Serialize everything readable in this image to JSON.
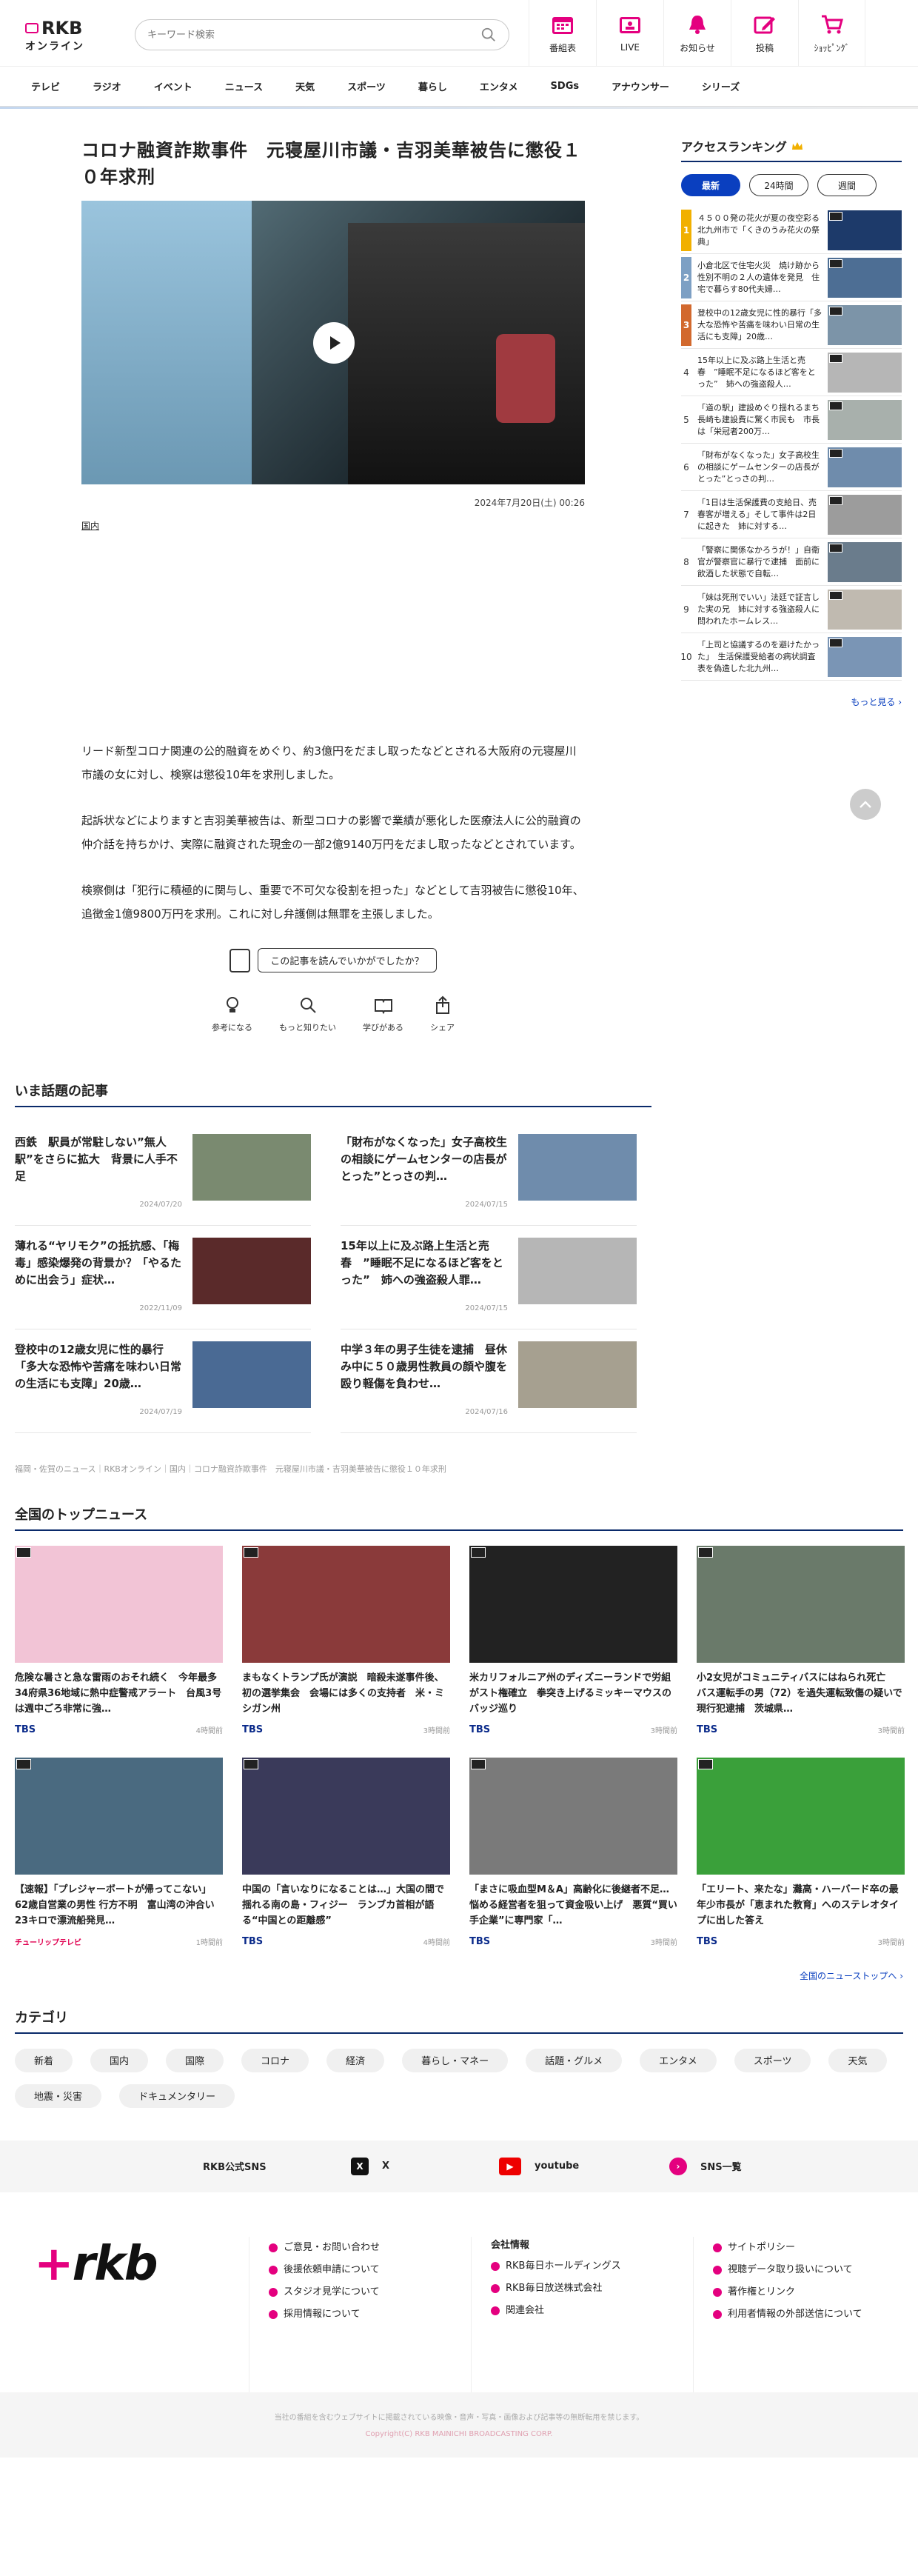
{
  "header": {
    "logo_main": "RKB",
    "logo_sub": "オンライン",
    "search_placeholder": "キーワード検索",
    "nav": [
      {
        "label": "番組表",
        "icon": "calendar-icon"
      },
      {
        "label": "LIVE",
        "icon": "live-icon"
      },
      {
        "label": "お知らせ",
        "icon": "bell-icon"
      },
      {
        "label": "投稿",
        "icon": "post-icon"
      },
      {
        "label": "ｼｮｯﾋﾟﾝｸﾞ",
        "icon": "cart-icon"
      }
    ]
  },
  "global_nav": [
    "テレビ",
    "ラジオ",
    "イベント",
    "ニュース",
    "天気",
    "スポーツ",
    "暮らし",
    "エンタメ",
    "SDGs",
    "アナウンサー",
    "シリーズ"
  ],
  "article": {
    "title": "コロナ融資詐欺事件　元寝屋川市議・吉羽美華被告に懲役１０年求刑",
    "date": "2024年7月20日(土) 00:26",
    "category": "国内",
    "paragraphs": [
      "リード新型コロナ関連の公的融資をめぐり、約3億円をだまし取ったなどとされる大阪府の元寝屋川市議の女に対し、検察は懲役10年を求刑しました。",
      "起訴状などによりますと吉羽美華被告は、新型コロナの影響で業績が悪化した医療法人に公的融資の仲介話を持ちかけ、実際に融資された現金の一部2億9140万円をだまし取ったなどとされています。",
      "検察側は「犯行に積極的に関与し、重要で不可欠な役割を担った」などとして吉羽被告に懲役10年、追徴金1億9800万円を求刑。これに対し弁護側は無罪を主張しました。"
    ],
    "feedback_question": "この記事を読んでいかがでしたか？",
    "reactions": [
      {
        "label": "参考になる",
        "icon": "lightbulb-icon"
      },
      {
        "label": "もっと知りたい",
        "icon": "magnifier-icon"
      },
      {
        "label": "学びがある",
        "icon": "book-icon"
      },
      {
        "label": "シェア",
        "icon": "share-icon"
      }
    ]
  },
  "ranking": {
    "title": "アクセスランキング",
    "tabs": [
      "最新",
      "24時間",
      "週間"
    ],
    "items": [
      {
        "rank": "1",
        "color": "#f1b000",
        "thumb": "#1d3a6a",
        "text": "４５００発の花火が夏の夜空彩る　北九州市で「くきのうみ花火の祭典」"
      },
      {
        "rank": "2",
        "color": "#7da0c4",
        "thumb": "#4d6e94",
        "text": "小倉北区で住宅火災　焼け跡から性別不明の２人の遺体を発見　住宅で暮らす80代夫婦…"
      },
      {
        "rank": "3",
        "color": "#d2692e",
        "thumb": "#7c94a8",
        "text": "登校中の12歳女児に性的暴行「多大な恐怖や苦痛を味わい日常の生活にも支障」20歳…"
      },
      {
        "rank": "4",
        "color": "",
        "thumb": "#b6b6b6",
        "text": "15年以上に及ぶ路上生活と売春　”睡眠不足になるほど客をとった”　姉への強盗殺人…"
      },
      {
        "rank": "5",
        "color": "",
        "thumb": "#a8b0ac",
        "text": "「道の駅」建設めぐり揺れるまち　長崎も建設費に驚く市民も　市長は「栄冠者200万…"
      },
      {
        "rank": "6",
        "color": "",
        "thumb": "#6f8cac",
        "text": "「財布がなくなった」女子高校生の相談にゲームセンターの店長がとった”とっさの判…"
      },
      {
        "rank": "7",
        "color": "",
        "thumb": "#9c9c9c",
        "text": "「1日は生活保護費の支給日、売春客が増える」そして事件は2日に起きた　姉に対する…"
      },
      {
        "rank": "8",
        "color": "",
        "thumb": "#6a7c8c",
        "text": "「警察に関係なかろうが！」自衛官が警察官に暴行で逮捕　面前に飲酒した状態で自転…"
      },
      {
        "rank": "9",
        "color": "",
        "thumb": "#c0bab0",
        "text": "「妹は死刑でいい」法廷で証言した実の兄　姉に対する強盗殺人に問われたホームレス…"
      },
      {
        "rank": "10",
        "color": "",
        "thumb": "#7a95b5",
        "text": "「上司と協議するのを避けたかった」　生活保護受給者の病状調査表を偽造した北九州…"
      }
    ],
    "more": "もっと見る ›"
  },
  "topics": {
    "title": "いま話題の記事",
    "items": [
      {
        "text": "西鉄　駅員が常駐しない”無人駅”をさらに拡大　背景に人手不足",
        "date": "2024/07/20",
        "thumb": "#7a8a70"
      },
      {
        "text": "「財布がなくなった」女子高校生の相談にゲームセンターの店長がとった”とっさの判…",
        "date": "2024/07/15",
        "thumb": "#6f8cac"
      },
      {
        "text": "薄れる“ヤリモク”の抵抗感、「梅毒」感染爆発の背景か？「やるために出会う」症状…",
        "date": "2022/11/09",
        "thumb": "#5a2a2a"
      },
      {
        "text": "15年以上に及ぶ路上生活と売春　”睡眠不足になるほど客をとった”　姉への強盗殺人罪…",
        "date": "2024/07/15",
        "thumb": "#b6b6b6"
      },
      {
        "text": "登校中の12歳女児に性的暴行「多大な恐怖や苦痛を味わい日常の生活にも支障」20歳…",
        "date": "2024/07/19",
        "thumb": "#4a6a94"
      },
      {
        "text": "中学３年の男子生徒を逮捕　昼休み中に５０歳男性教員の顔や腹を殴り軽傷を負わせ…",
        "date": "2024/07/16",
        "thumb": "#a6a090"
      }
    ]
  },
  "breadcrumb": "福岡・佐賀のニュース｜RKBオンライン｜国内｜コロナ融資詐欺事件　元寝屋川市議・吉羽美華被告に懲役１０年求刑",
  "national": {
    "title": "全国のトップニュース",
    "items": [
      {
        "text": "危険な暑さと急な雷雨のおそれ続く　今年最多34府県36地域に熱中症警戒アラート　台風3号は週中ごろ非常に強…",
        "source": "TBS",
        "time": "4時間前",
        "thumb": "#f2c4d6"
      },
      {
        "text": "まもなくトランプ氏が演説　暗殺未遂事件後、初の選挙集会　会場には多くの支持者　米・ミシガン州",
        "source": "TBS",
        "time": "3時間前",
        "thumb": "#8a3a3a"
      },
      {
        "text": "米カリフォルニア州のディズニーランドで労組がスト権確立　拳突き上げるミッキーマウスのバッジ巡り",
        "source": "TBS",
        "time": "3時間前",
        "thumb": "#222222"
      },
      {
        "text": "小2女児がコミュニティバスにはねられ死亡　バス運転手の男（72）を過失運転致傷の疑いで現行犯逮捕　茨城県…",
        "source": "TBS",
        "time": "3時間前",
        "thumb": "#6a7a6a"
      },
      {
        "text": "【速報】「プレジャーボートが帰ってこない」62歳自営業の男性 行方不明　富山湾の沖合い23キロで漂流船発見…",
        "source": "チューリップテレビ",
        "time": "1時間前",
        "thumb": "#4a6a80"
      },
      {
        "text": "中国の「言いなりになることは…」大国の間で揺れる南の島・フィジー　ランブカ首相が語る“中国との距離感”",
        "source": "TBS",
        "time": "4時間前",
        "thumb": "#3a3a5a"
      },
      {
        "text": "「まさに吸血型M＆A」高齢化に後継者不足…悩める経営者を狙って資金吸い上げ　悪質“買い手企業”に専門家「…",
        "source": "TBS",
        "time": "3時間前",
        "thumb": "#7a7a7a"
      },
      {
        "text": "「エリート、来たな」灘高・ハーバード卒の最年少市長が「恵まれた教育」へのステレオタイプに出した答え",
        "source": "TBS",
        "time": "3時間前",
        "thumb": "#3aa03a"
      }
    ],
    "more": "全国のニューストップへ ›"
  },
  "categories": {
    "title": "カテゴリ",
    "items": [
      "新着",
      "国内",
      "国際",
      "コロナ",
      "経済",
      "暮らし・マネー",
      "話題・グルメ",
      "エンタメ",
      "スポーツ",
      "天気",
      "地震・災害",
      "ドキュメンタリー"
    ]
  },
  "sns": {
    "label": "RKB公式SNS",
    "items": [
      "X",
      "youtube",
      "SNS一覧"
    ]
  },
  "footer": {
    "logo_plus": "+",
    "logo_text": "rkb",
    "col1": [
      "ご意見・お問い合わせ",
      "後援依頼申請について",
      "スタジオ見学について",
      "採用情報について"
    ],
    "col2_title": "会社情報",
    "col2": [
      "RKB毎日ホールディングス",
      "RKB毎日放送株式会社",
      "関連会社"
    ],
    "col3": [
      "サイトポリシー",
      "視聴データ取り扱いについて",
      "著作権とリンク",
      "利用者情報の外部送信について"
    ],
    "notice": "当社の番組を含むウェブサイトに掲載されている映像・音声・写真・画像および記事等の無断転用を禁じます。",
    "copyright": "Copyright(C) RKB MAINICHI BROADCASTING CORP."
  },
  "colors": {
    "accent": "#0a3fbf",
    "brand": "#e4007f",
    "heading_rule": "#0a2a6a"
  }
}
